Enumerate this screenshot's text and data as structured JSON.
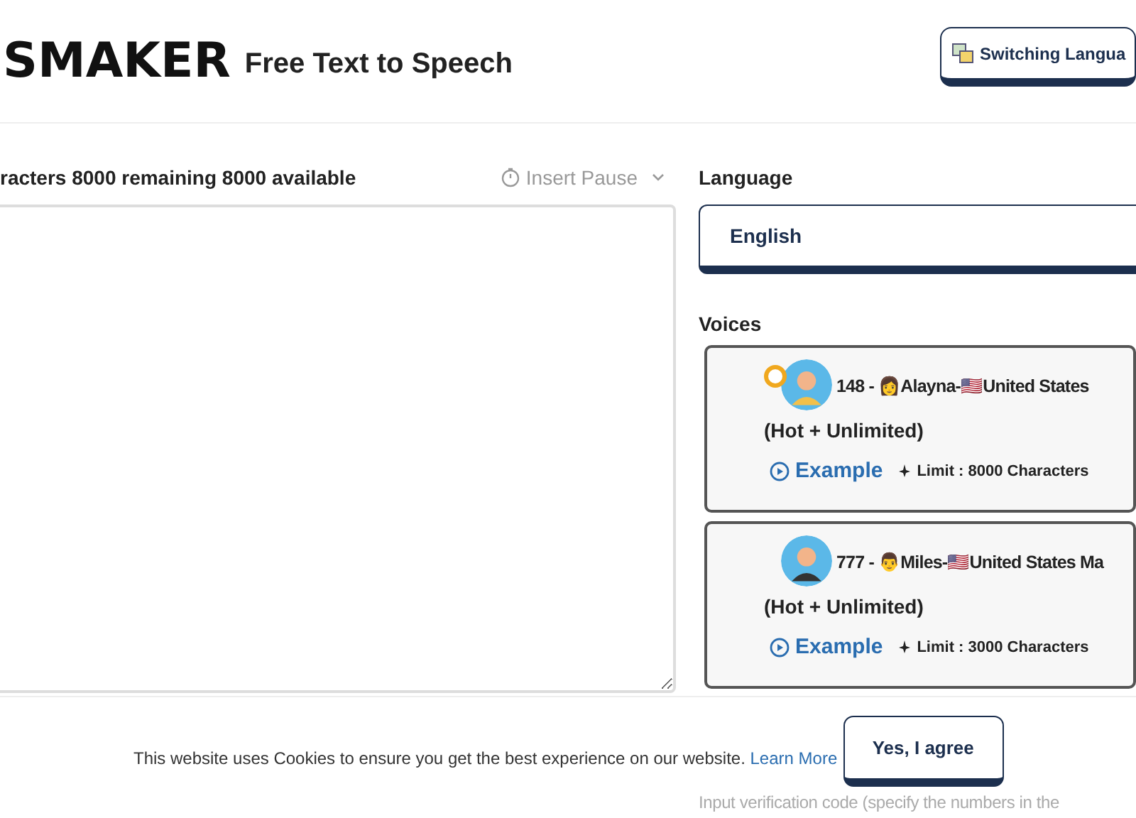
{
  "header": {
    "logo": "SMAKER",
    "title": "Free Text to Speech",
    "language_button": "Switching Langua"
  },
  "editor": {
    "counter": "racters 8000 remaining 8000 available",
    "insert_pause": "Insert Pause"
  },
  "language": {
    "label": "Language",
    "value": "English"
  },
  "voices": {
    "label": "Voices",
    "items": [
      {
        "name": "148 - 👩Alayna-🇺🇸United States",
        "tag": "(Hot + Unlimited)",
        "example": "Example",
        "limit": "Limit : 8000 Characters",
        "selected": true
      },
      {
        "name": "777 - 👨Miles-🇺🇸United States Ma",
        "tag": "(Hot + Unlimited)",
        "example": "Example",
        "limit": "Limit : 3000 Characters",
        "selected": false
      }
    ]
  },
  "verification": {
    "hint": "Input verification code (specify the numbers in the"
  },
  "cookie": {
    "message": "This website uses Cookies to ensure you get the best experience on our website.",
    "link": "Learn More",
    "button": "Yes, I agree"
  }
}
